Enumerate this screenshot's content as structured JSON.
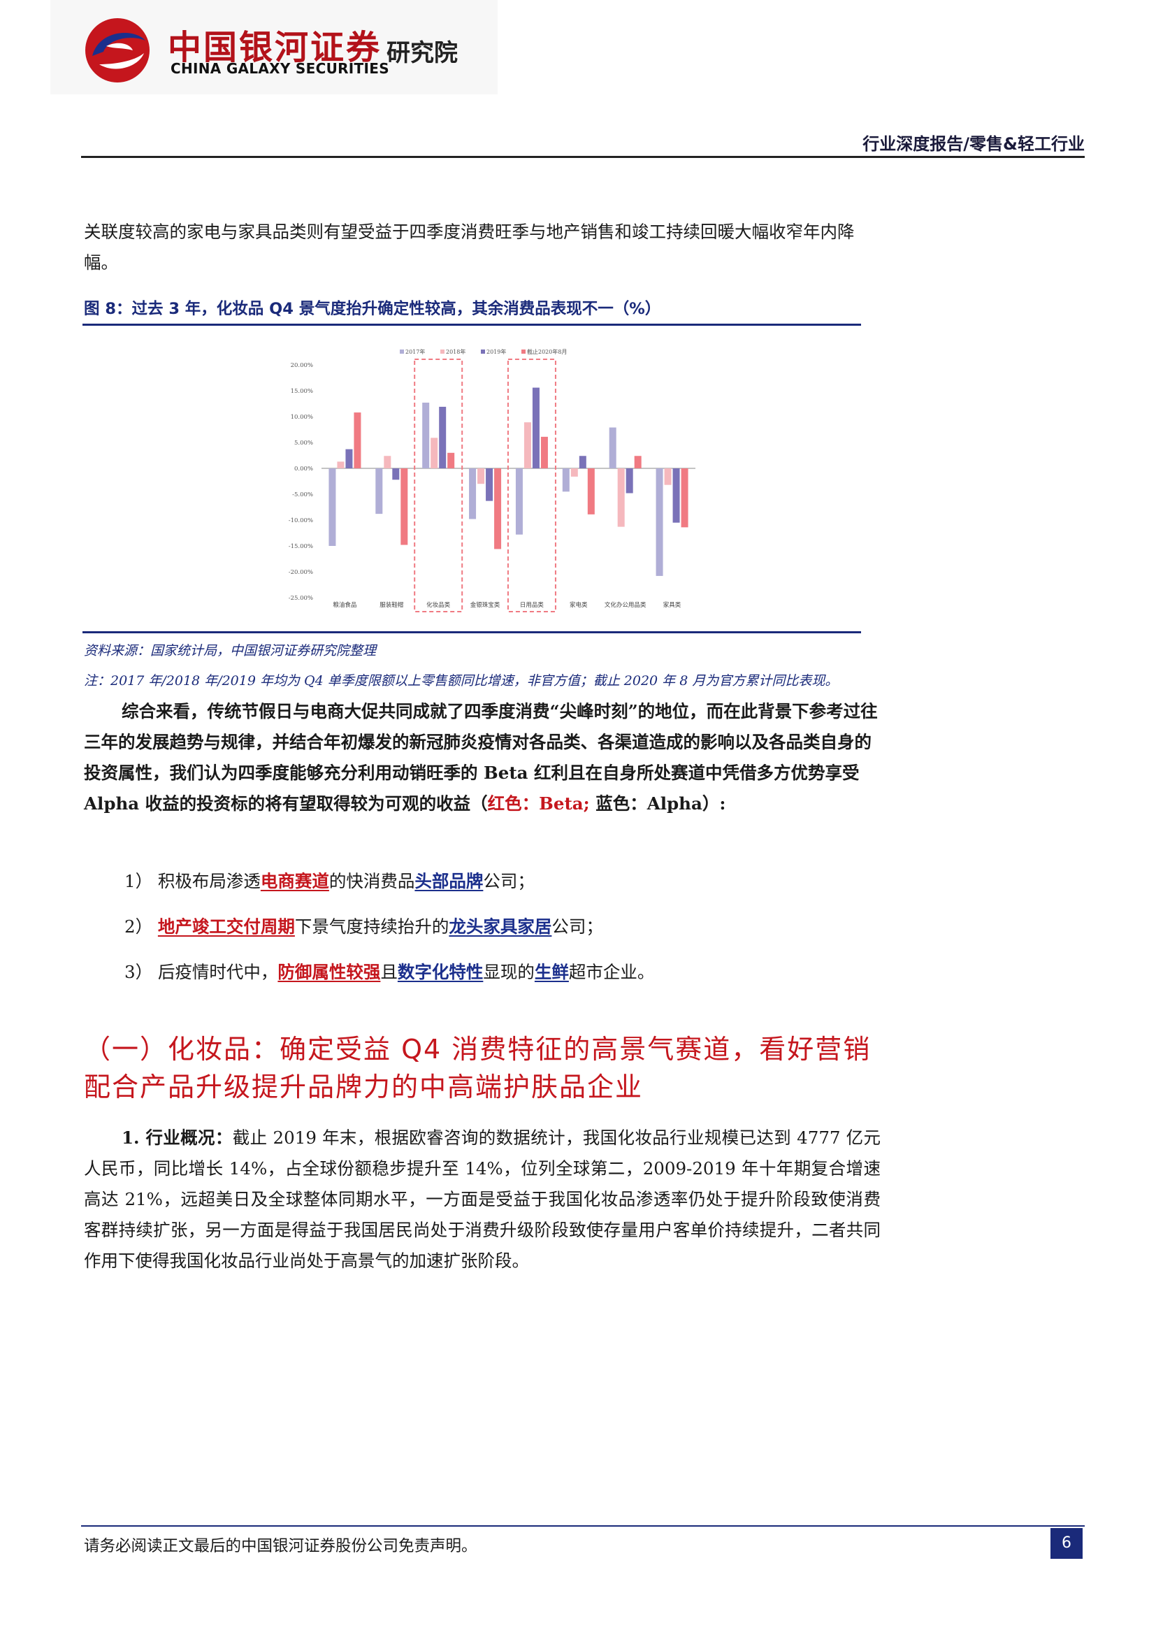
{
  "header": {
    "logo_cn": "中国银河证券",
    "logo_suffix": "研究院",
    "logo_en": "CHINA GALAXY SECURITIES",
    "report_type": "行业深度报告/零售&轻工行业"
  },
  "paragraph_intro": "关联度较高的家电与家具品类则有望受益于四季度消费旺季与地产销售和竣工持续回暖大幅收窄年内降幅。",
  "figure": {
    "title": "图 8：过去 3 年，化妆品 Q4 景气度抬升确定性较高，其余消费品表现不一（%）",
    "source": "资料来源：国家统计局，中国银河证券研究院整理",
    "note": "注：2017 年/2018 年/2019 年均为 Q4 单季度限额以上零售额同比增速，非官方值；截止 2020 年 8 月为官方累计同比表现。"
  },
  "chart_data": {
    "type": "bar",
    "categories": [
      "粮油食品",
      "服装鞋帽",
      "化妆品类",
      "金银珠宝类",
      "日用品类",
      "家电类",
      "文化办公用品类",
      "家具类"
    ],
    "series": [
      {
        "name": "2017年",
        "color": "#b0aed6",
        "values": [
          -15.0,
          -8.8,
          12.7,
          -9.8,
          -12.8,
          -4.5,
          7.9,
          -20.8
        ]
      },
      {
        "name": "2018年",
        "color": "#f5b8bd",
        "values": [
          1.3,
          2.4,
          5.9,
          -3.0,
          8.9,
          -1.6,
          -11.3,
          -3.2
        ]
      },
      {
        "name": "2019年",
        "color": "#7a72b8",
        "values": [
          3.7,
          -2.2,
          11.9,
          -6.3,
          15.6,
          2.4,
          -4.8,
          -10.5
        ]
      },
      {
        "name": "截止2020年8月",
        "color": "#f07a82",
        "values": [
          10.8,
          -14.8,
          3.0,
          -15.6,
          6.1,
          -8.9,
          2.4,
          -11.4
        ]
      }
    ],
    "ylim": [
      -25,
      20
    ],
    "yticks": [
      "20.00%",
      "15.00%",
      "10.00%",
      "5.00%",
      "0.00%",
      "-5.00%",
      "-10.00%",
      "-15.00%",
      "-20.00%",
      "-25.00%"
    ],
    "highlighted_categories": [
      "化妆品类",
      "日用品类"
    ],
    "legend_position": "top"
  },
  "paragraph_summary": {
    "part1": "综合来看，传统节假日与电商大促共同成就了四季度消费“尖峰时刻”的地位，而在此背景下参考过往三年的发展趋势与规律，并结合年初爆发的新冠肺炎疫情对各品类、各渠道造成的影响以及各品类自身的投资属性，我们认为四季度能够充分利用动销旺季的 Beta 红利且在自身所处赛道中凭借多方优势享受 Alpha 收益的投资标的将有望取得较为可观的收益（",
    "red_label": "红色：Beta;",
    "sep": " ",
    "blue_label": "蓝色：Alpha",
    "part_end": "）:"
  },
  "list": [
    {
      "num": "1）",
      "t1": "积极布局渗透",
      "h1": "电商赛道",
      "t2": "的快消费品",
      "h2": "头部品牌",
      "t3": "公司；"
    },
    {
      "num": "2）",
      "h1": "地产竣工交付周期",
      "t2": "下景气度持续抬升的",
      "h2": "龙头家具家居",
      "t3": "公司；"
    },
    {
      "num": "3）",
      "t1": "后疫情时代中，",
      "h1": "防御属性较强",
      "t2": "且",
      "h2": "数字化特性",
      "t3": "显现的",
      "h3": "生鲜",
      "t4": "超市企业。"
    }
  ],
  "section_heading": "（一）化妆品：确定受益 Q4 消费特征的高景气赛道，看好营销配合产品升级提升品牌力的中高端护肤品企业",
  "paragraph_industry": {
    "label": "1. 行业概况：",
    "text": "截止 2019 年末，根据欧睿咨询的数据统计，我国化妆品行业规模已达到 4777 亿元人民币，同比增长 14%，占全球份额稳步提升至 14%，位列全球第二，2009-2019 年十年期复合增速高达 21%，远超美日及全球整体同期水平，一方面是受益于我国化妆品渗透率仍处于提升阶段致使消费客群持续扩张，另一方面是得益于我国居民尚处于消费升级阶段致使存量用户客单价持续提升，二者共同作用下使得我国化妆品行业尚处于高景气的加速扩张阶段。"
  },
  "footer": {
    "disclaimer": "请务必阅读正文最后的中国银河证券股份公司免责声明。",
    "page": "6"
  }
}
